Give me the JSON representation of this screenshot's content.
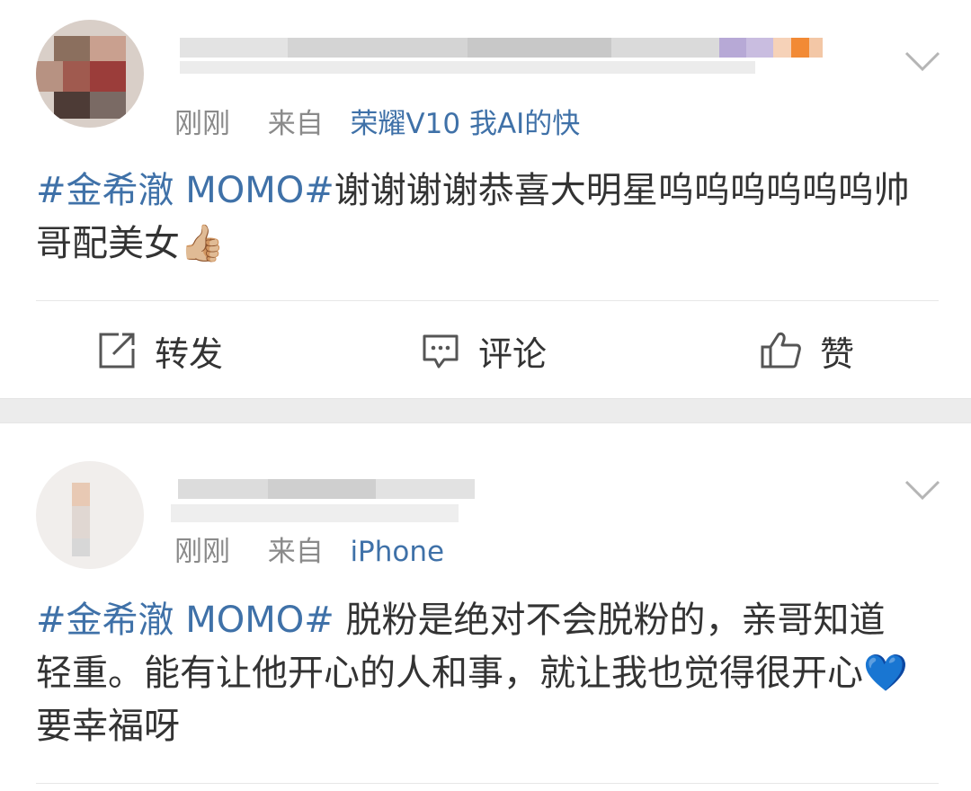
{
  "posts": [
    {
      "timestamp": "刚刚",
      "from_label": "来自",
      "source": "荣耀V10 我AI的快",
      "hashtag": "#金希澈 MOMO#",
      "text": "谢谢谢谢恭喜大明星呜呜呜呜呜呜帅哥配美女",
      "emoji": "👍🏼"
    },
    {
      "timestamp": "刚刚",
      "from_label": "来自",
      "source": "iPhone",
      "hashtag": "#金希澈 MOMO#",
      "text": " 脱粉是绝对不会脱粉的，亲哥知道轻重。能有让他开心的人和事，就让我也觉得很开心",
      "emoji": "💙",
      "text_after_emoji": "要幸福呀"
    }
  ],
  "actions": {
    "repost_label": "转发",
    "comment_label": "评论",
    "like_label": "赞"
  },
  "colors": {
    "link_blue": "#3f71a8",
    "meta_gray": "#8a8a8a",
    "text": "#333333",
    "separator": "#ececec"
  }
}
